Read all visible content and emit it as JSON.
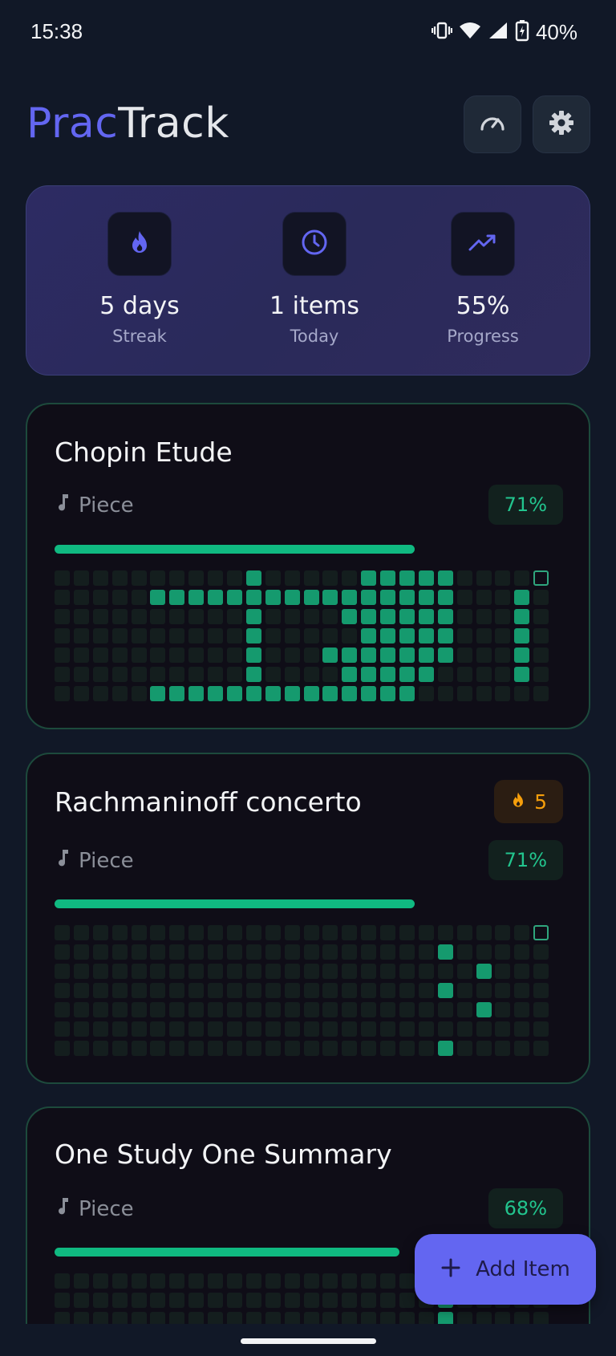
{
  "status_bar": {
    "time": "15:38",
    "battery": "40%"
  },
  "header": {
    "title_part1": "Prac",
    "title_part2": "Track",
    "dashboard_icon": "speedometer-icon",
    "settings_icon": "gear-icon"
  },
  "stats": [
    {
      "icon": "flame-icon",
      "value": "5 days",
      "label": "Streak"
    },
    {
      "icon": "clock-icon",
      "value": "1 items",
      "label": "Today"
    },
    {
      "icon": "trending-up-icon",
      "value": "55%",
      "label": "Progress"
    }
  ],
  "items": [
    {
      "title": "Chopin Etude",
      "type": "Piece",
      "percent": "71%",
      "progress": 0.71,
      "streak": null,
      "heatmap": [
        "0000000000100000111110000T",
        "0000011111111111111110001",
        "0000000000100001111110001",
        "0000000000100000111110001",
        "0000000000100011111110001",
        "0000000000100001111100001",
        "0000011111111111111000000"
      ]
    },
    {
      "title": "Rachmaninoff concerto",
      "type": "Piece",
      "percent": "71%",
      "progress": 0.71,
      "streak": "5",
      "heatmap": [
        "0000000000000000000000000T",
        "0000000000000000000010000",
        "0000000000000000000000100001",
        "0000000000000000000010000001",
        "0000000000000000000000100001",
        "0000000000000000000000000001",
        "0000000000000000000010000001"
      ]
    },
    {
      "title": "One Study One Summary",
      "type": "Piece",
      "percent": "68%",
      "progress": 0.68,
      "streak": null,
      "heatmap": [
        "00000000000000000000000000",
        "00000000000000000000100000",
        "00000000000000000000100000"
      ]
    }
  ],
  "fab": {
    "icon": "plus-icon",
    "label": "Add Item"
  },
  "colors": {
    "accent": "#6366f1",
    "green": "#10b981",
    "streak": "#f59e0b"
  }
}
